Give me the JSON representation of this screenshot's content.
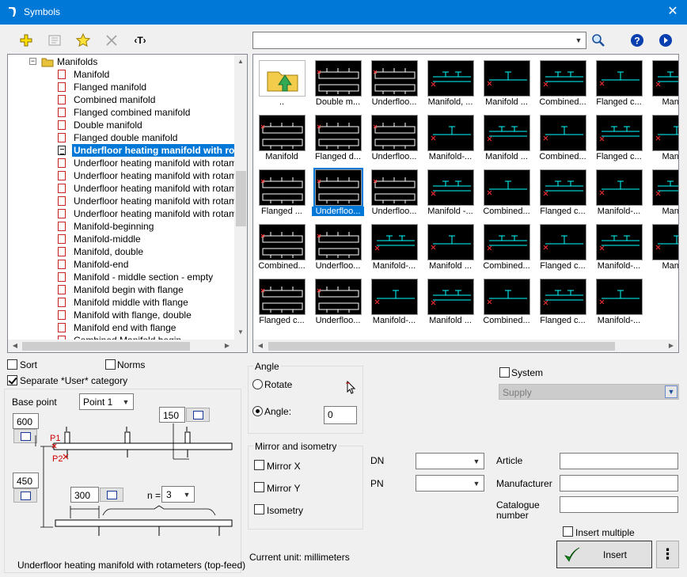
{
  "window": {
    "title": "Symbols",
    "close_glyph": "✕"
  },
  "toolbar": {
    "icons": [
      "add-plus-icon",
      "properties-icon",
      "favorite-star-icon",
      "delete-cross-icon",
      "text-icon"
    ],
    "text_label": "‹T›",
    "search_value": "",
    "search_icon": "magnifier-icon",
    "help_icon": "help-icon",
    "next_icon": "arrow-right-icon"
  },
  "tree": {
    "folder": "Manifolds",
    "items": [
      "Manifold",
      "Flanged manifold",
      "Combined manifold",
      "Flanged combined manifold",
      "Double manifold",
      "Flanged double manifold",
      "Underfloor heating manifold with rotameters (top-feed)",
      "Underfloor heating manifold with rotameters",
      "Underfloor heating manifold with rotameters",
      "Underfloor heating manifold with rotameters",
      "Underfloor heating manifold with rotameters",
      "Underfloor heating manifold with rotameters",
      "Manifold-beginning",
      "Manifold-middle",
      "Manifold, double",
      "Manifold-end",
      "Manifold - middle section - empty",
      "Manifold begin with flange",
      "Manifold middle with flange",
      "Manifold with flange, double",
      "Manifold end with flange",
      "Combined Manifold begin"
    ],
    "selected_index": 6
  },
  "thumbnails": {
    "rows": [
      [
        "..",
        "Double m...",
        "Underfloo...",
        "Manifold, ...",
        "Manifold ...",
        "Combined...",
        "Flanged c...",
        "Manifo"
      ],
      [
        "Manifold",
        "Flanged d...",
        "Underfloo...",
        "Manifold-...",
        "Manifold ...",
        "Combined...",
        "Flanged c...",
        "Manifo"
      ],
      [
        "Flanged ...",
        "Underfloo...",
        "Underfloo...",
        "Manifold -...",
        "Combined...",
        "Flanged c...",
        "Manifold-...",
        "Manifo"
      ],
      [
        "Combined...",
        "Underfloo...",
        "Manifold-...",
        "Manifold ...",
        "Combined...",
        "Flanged c...",
        "Manifold-...",
        "Manifo"
      ],
      [
        "Flanged c...",
        "Underfloo...",
        "Manifold-...",
        "Manifold ...",
        "Combined...",
        "Flanged c...",
        "Manifold-..."
      ]
    ],
    "selected": [
      2,
      1
    ]
  },
  "options": {
    "sort": "Sort",
    "sort_checked": false,
    "norms": "Norms",
    "norms_checked": false,
    "separate_user": "Separate *User* category",
    "separate_checked": true
  },
  "diagram": {
    "base_point_label": "Base point",
    "base_point_value": "Point 1",
    "dim_600": "600",
    "dim_150": "150",
    "dim_450": "450",
    "dim_300": "300",
    "n_label": "n =",
    "n_value": "3",
    "p1": "P1",
    "p2": "P2",
    "caption": "Underfloor heating manifold with rotameters (top-feed)"
  },
  "angle": {
    "title": "Angle",
    "rotate": "Rotate",
    "angle_label": "Angle:",
    "angle_value": "0",
    "selected": "angle"
  },
  "mirror": {
    "title": "Mirror and isometry",
    "mirror_x": "Mirror X",
    "mirror_y": "Mirror Y",
    "isometry": "Isometry"
  },
  "current_unit": "Current unit: millimeters",
  "system": {
    "label": "System",
    "checked": false,
    "value": "Supply"
  },
  "fields": {
    "dn": "DN",
    "pn": "PN",
    "article": "Article",
    "manufacturer": "Manufacturer",
    "catalogue": [
      "Catalogue",
      "number"
    ]
  },
  "insert_multiple": "Insert multiple",
  "insert_button": "Insert",
  "more_glyph": "⋮",
  "colors": {
    "accent": "#0078d7",
    "thumb_bg": "#000000",
    "line_white": "#ffffff",
    "line_cyan": "#00ffff",
    "line_red": "#ff3030",
    "folder": "#e8c23a"
  }
}
